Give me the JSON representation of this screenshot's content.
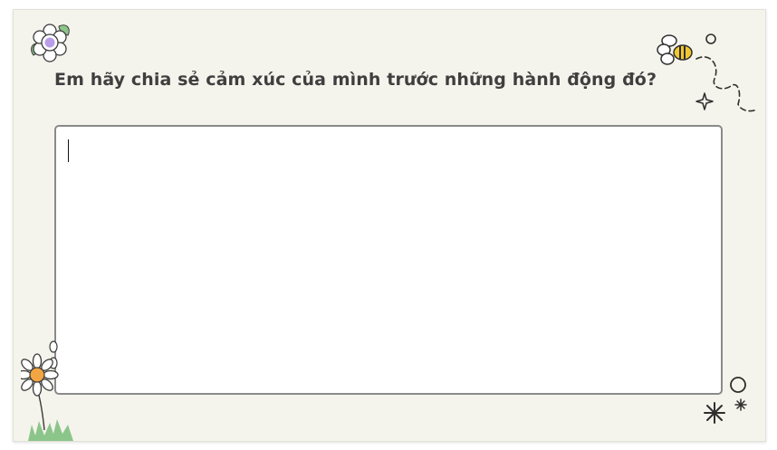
{
  "question": {
    "text": "Em hãy chia sẻ cảm xúc của mình trước những hành động đó?"
  },
  "answer": {
    "value": "",
    "placeholder": ""
  },
  "decorations": {
    "top_left": "flower-icon",
    "top_right": "bee-icon",
    "top_right_extra": "sparkle-icon",
    "bottom_left": "daisy-icon",
    "bottom_right": "star-burst-icon"
  },
  "colors": {
    "card_background": "#f5f4ec",
    "text": "#3f3f3f",
    "input_border": "#8a8a8a",
    "accent_green": "#8cc58a",
    "accent_purple": "#b89de8",
    "accent_orange": "#f2a541",
    "accent_yellow": "#f1c832"
  }
}
